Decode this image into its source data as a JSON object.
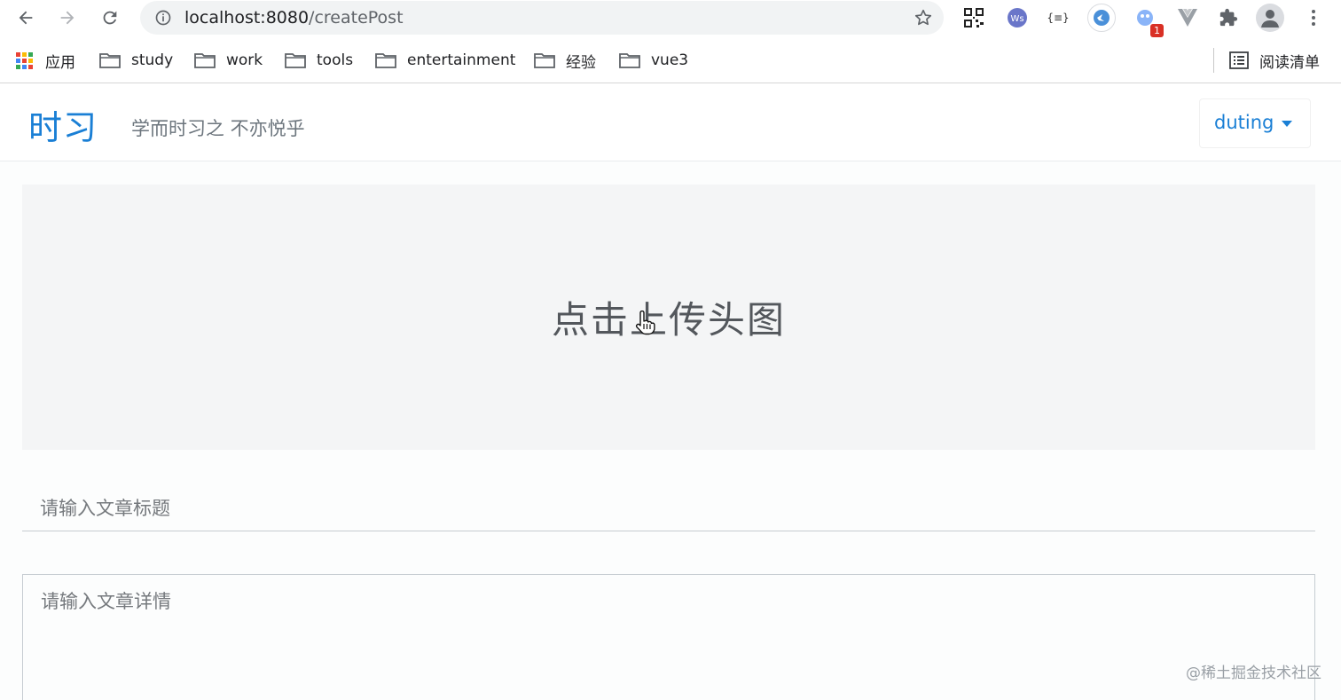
{
  "browser": {
    "url_host": "localhost:8080",
    "url_path": "/createPost",
    "extensions": [
      {
        "name": "qr-code-icon"
      },
      {
        "name": "ws-extension-icon",
        "label": "Ws"
      },
      {
        "name": "json-formatter-icon",
        "label": "{≡}"
      },
      {
        "name": "blue-bird-icon"
      },
      {
        "name": "badged-extension-icon",
        "badge": "1"
      },
      {
        "name": "vue-devtools-icon"
      },
      {
        "name": "puzzle-icon"
      }
    ]
  },
  "bookmarks": {
    "apps_label": "应用",
    "folders": [
      "study",
      "work",
      "tools",
      "entertainment",
      "经验",
      "vue3"
    ],
    "reading_list_label": "阅读清单"
  },
  "app": {
    "brand": "时习",
    "slogan": "学而时习之 不亦悦乎",
    "user_name": "duting",
    "upload_label": "点击上传头图",
    "title_placeholder": "请输入文章标题",
    "content_placeholder": "请输入文章详情",
    "brand_color": "#1a7fd5"
  },
  "watermark": "@稀土掘金技术社区"
}
